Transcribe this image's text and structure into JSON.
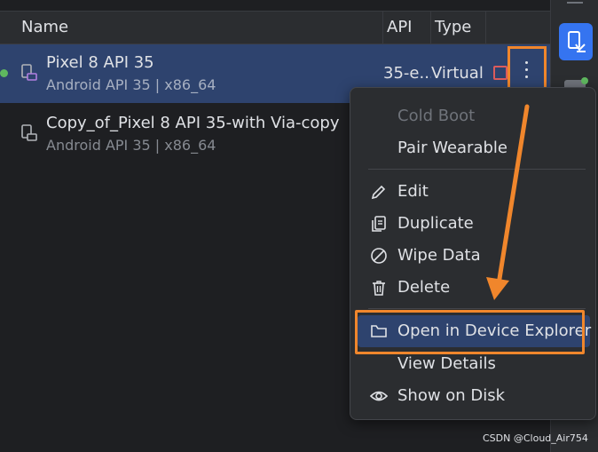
{
  "table": {
    "headers": {
      "name": "Name",
      "api": "API",
      "type": "Type"
    },
    "rows": [
      {
        "name": "Pixel 8 API 35",
        "subtitle": "Android API 35 | x86_64",
        "api": "35-e...",
        "type": "Virtual",
        "selected": true,
        "running": true
      },
      {
        "name": "Copy_of_Pixel 8 API 35-with Via-copy",
        "subtitle": "Android API 35 | x86_64",
        "api": "",
        "type": "",
        "selected": false,
        "running": false
      }
    ]
  },
  "menu": {
    "items": [
      {
        "label": "Cold Boot",
        "icon": "",
        "enabled": false
      },
      {
        "label": "Pair Wearable",
        "icon": "",
        "enabled": true
      },
      {
        "label": "Edit",
        "icon": "pencil-icon",
        "enabled": true
      },
      {
        "label": "Duplicate",
        "icon": "duplicate-icon",
        "enabled": true
      },
      {
        "label": "Wipe Data",
        "icon": "wipe-icon",
        "enabled": true
      },
      {
        "label": "Delete",
        "icon": "trash-icon",
        "enabled": true
      },
      {
        "label": "Open in Device Explorer",
        "icon": "folder-icon",
        "enabled": true,
        "highlighted": true
      },
      {
        "label": "View Details",
        "icon": "",
        "enabled": true
      },
      {
        "label": "Show on Disk",
        "icon": "eye-icon",
        "enabled": true
      }
    ]
  },
  "watermark": "CSDN @Cloud_Air754",
  "colors": {
    "accent": "#3574f0",
    "selection": "#2e436e",
    "annotation": "#f0862c",
    "running": "#5fb85f",
    "stop": "#db5c5c"
  }
}
